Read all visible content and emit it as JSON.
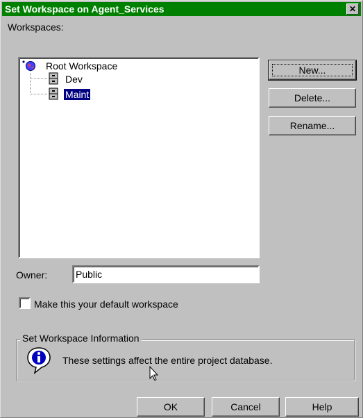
{
  "window": {
    "title": "Set Workspace on Agent_Services",
    "close_glyph": "✕"
  },
  "workspaces": {
    "label": "Workspaces:",
    "tree": {
      "root": "Root Workspace",
      "children": [
        {
          "label": "Dev",
          "selected": false
        },
        {
          "label": "Maint",
          "selected": true
        }
      ]
    }
  },
  "buttons": {
    "new": "New...",
    "delete": "Delete...",
    "rename": "Rename..."
  },
  "owner": {
    "label": "Owner:",
    "value": "Public"
  },
  "default_checkbox": {
    "label": "Make this your default workspace",
    "checked": false
  },
  "info_group": {
    "title": "Set Workspace Information",
    "message": "These settings affect the entire project database."
  },
  "footer": {
    "ok": "OK",
    "cancel": "Cancel",
    "help": "Help"
  },
  "colors": {
    "titlebar": "#008000",
    "selection": "#000080",
    "face": "#c0c0c0"
  }
}
